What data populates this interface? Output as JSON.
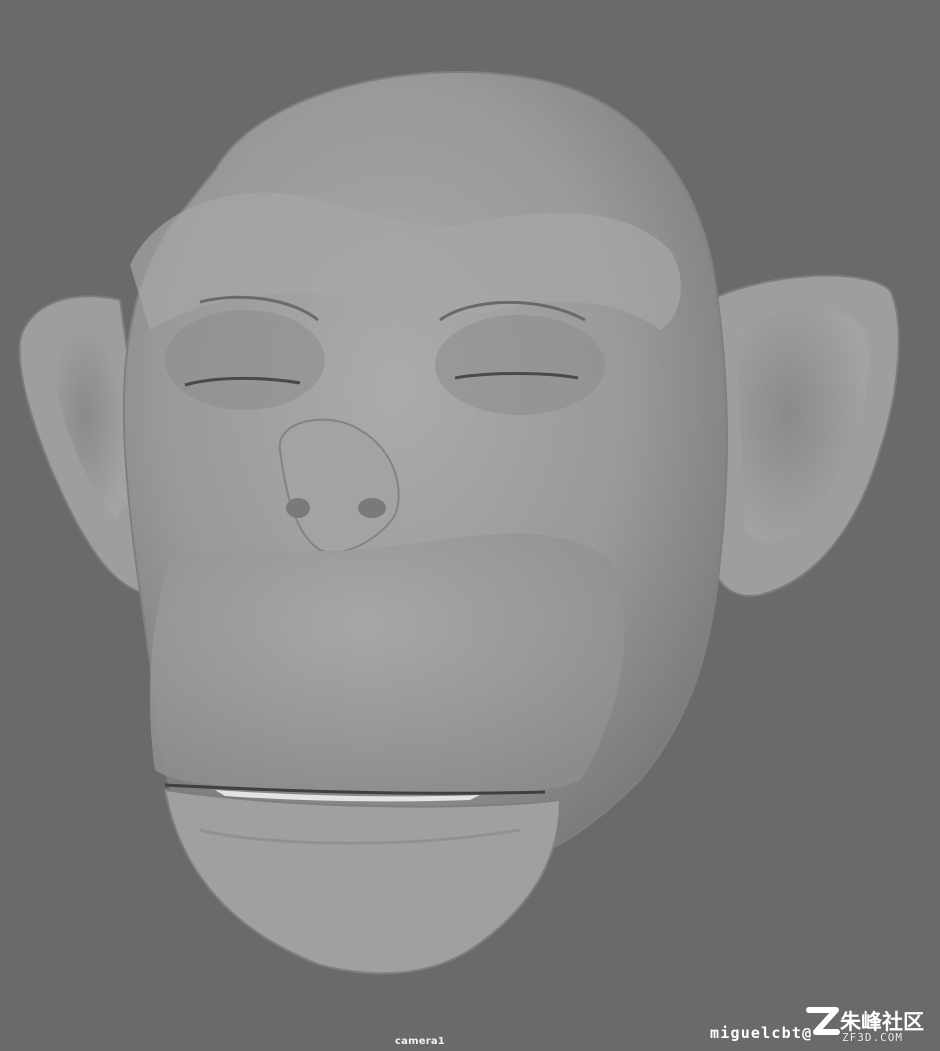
{
  "viewport": {
    "camera_label": "camera1",
    "subject_icon": "chimpanzee-head-sculpt",
    "background_color": "#6a6a6a",
    "model_color": "#9b9b9b"
  },
  "overlay": {
    "author": "miguelcbt@",
    "watermark_text": "朱峰社区",
    "watermark_url": "ZF3D.COM",
    "watermark_icon": "zf-logo"
  }
}
